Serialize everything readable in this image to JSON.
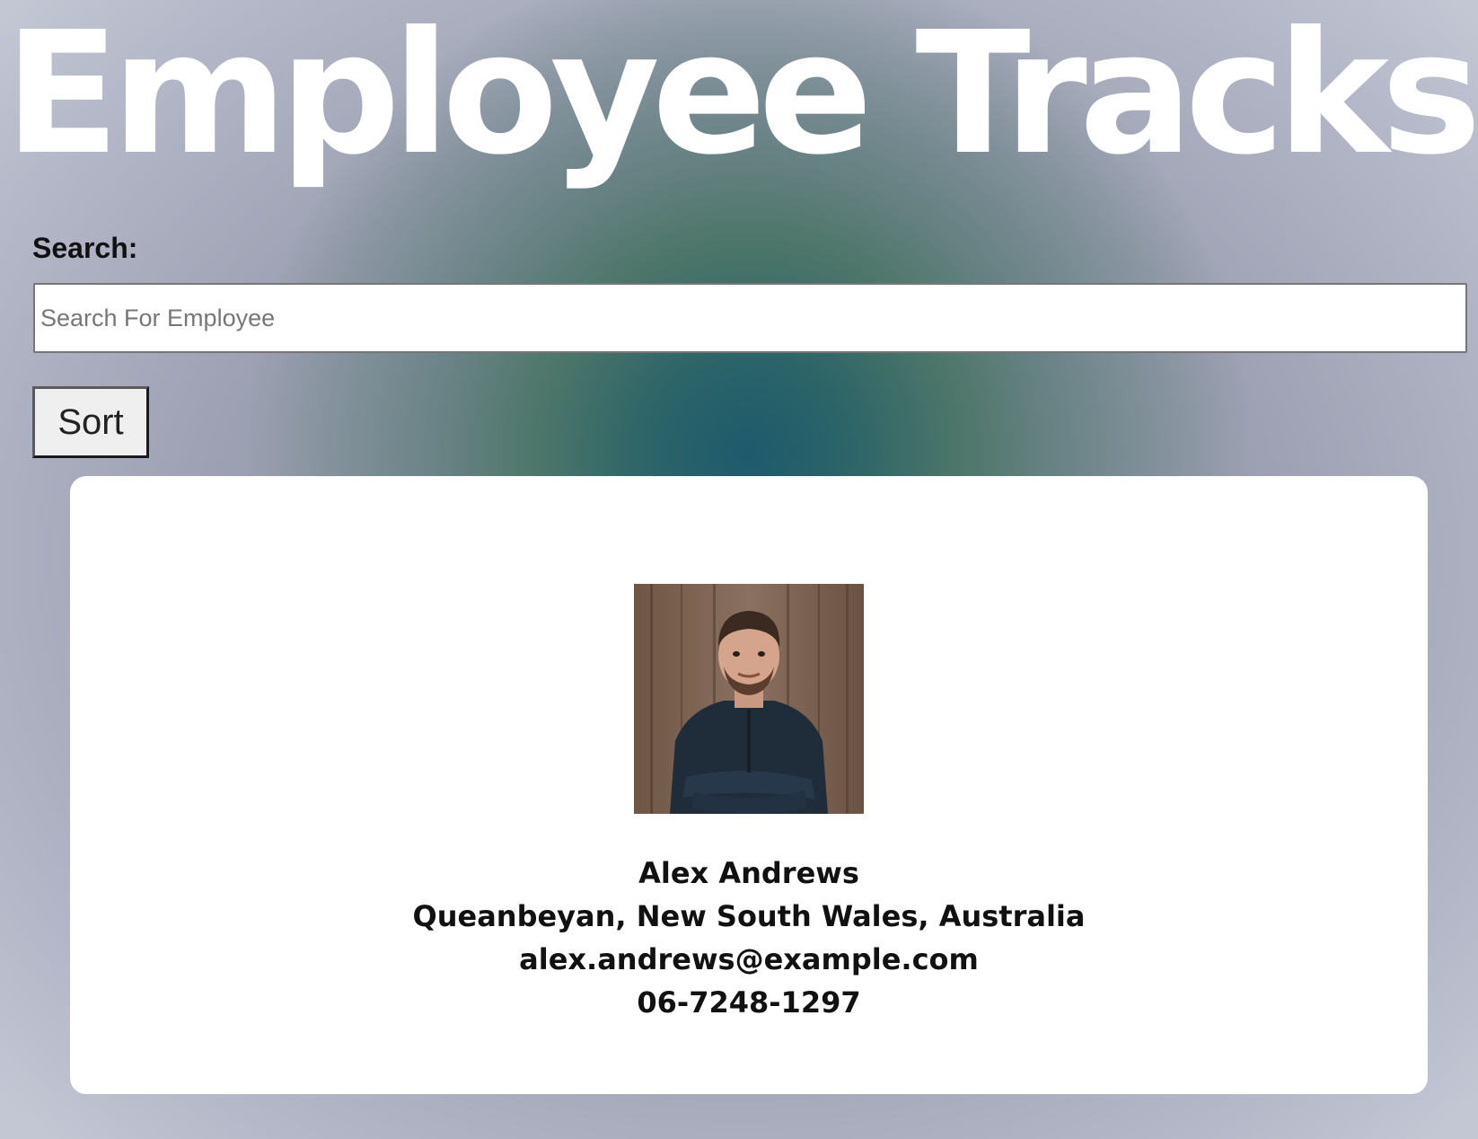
{
  "header": {
    "title": "Employee Tracks"
  },
  "search": {
    "label": "Search:",
    "placeholder": "Search For Employee",
    "value": ""
  },
  "sort": {
    "label": "Sort"
  },
  "employees": [
    {
      "name": "Alex Andrews",
      "location": "Queanbeyan, New South Wales, Australia",
      "email": "alex.andrews@example.com",
      "phone": "06-7248-1297",
      "photo_icon": "employee-photo"
    }
  ],
  "colors": {
    "card_background": "#ffffff",
    "title_color": "#ffffff",
    "background_center": "#1d5a6c",
    "background_edge": "#c3c6d3"
  }
}
